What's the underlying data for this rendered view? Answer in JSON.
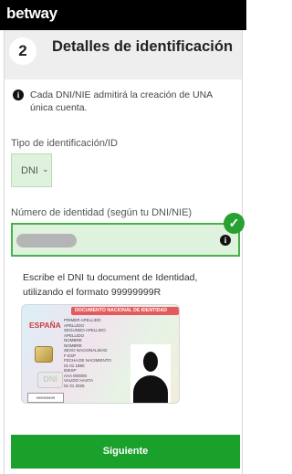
{
  "app": {
    "logo_text": "betway"
  },
  "step": {
    "number": "2",
    "title": "Detalles de identificación"
  },
  "info": {
    "icon": "info-icon",
    "text": "Cada DNI/NIE admitirá la creación de UNA única cuenta."
  },
  "id_type": {
    "label": "Tipo de identificación/ID",
    "selected": "DNI"
  },
  "id_number": {
    "label": "Número de identidad (según tu DNI/NIE)",
    "value_masked": true,
    "status": "valid",
    "status_color": "#27a12f"
  },
  "help": {
    "text": "Escribe el DNI tu document de Identidad, utilizando el formato 99999999R"
  },
  "card_image": {
    "band": "DOCUMENTO NACIONAL DE IDENTIDAD",
    "country": "ESPAÑA",
    "mark": "DNI",
    "number": "99999999R",
    "fields": [
      "PRIMER APELLIDO",
      "APELLIDO",
      "SEGUNDO APELLIDO",
      "APELLIDO",
      "NOMBRE",
      "NOMBRE",
      "SEXO   NACIONALIDAD",
      "F    ESP",
      "FECHA DE NACIMIENTO",
      "01   01   1980",
      "IDESP",
      "AAA 000000",
      "VALIDO HASTA",
      "01   01   2025"
    ]
  },
  "submit": {
    "label": "Siguiente",
    "color": "#19a12b"
  }
}
